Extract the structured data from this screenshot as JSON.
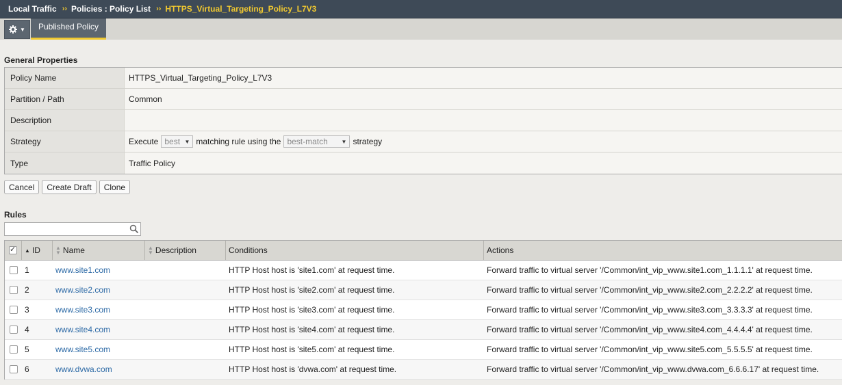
{
  "breadcrumb": {
    "items": [
      "Local Traffic",
      "Policies : Policy List"
    ],
    "separator": "››",
    "current": "HTTPS_Virtual_Targeting_Policy_L7V3"
  },
  "tabs": {
    "gear_icon": "gear-icon",
    "active_label": "Published Policy"
  },
  "general": {
    "title": "General Properties",
    "rows": [
      {
        "label": "Policy Name",
        "value": "HTTPS_Virtual_Targeting_Policy_L7V3"
      },
      {
        "label": "Partition / Path",
        "value": "Common"
      },
      {
        "label": "Description",
        "value": ""
      },
      {
        "label": "Strategy",
        "value": ""
      },
      {
        "label": "Type",
        "value": "Traffic Policy"
      }
    ],
    "strategy": {
      "prefix": "Execute",
      "first_select": "best",
      "middle": "matching rule using the",
      "second_select": "best-match",
      "suffix": "strategy"
    }
  },
  "buttons": {
    "cancel": "Cancel",
    "create_draft": "Create Draft",
    "clone": "Clone"
  },
  "rules": {
    "title": "Rules",
    "search_value": "",
    "columns": {
      "id": "ID",
      "name": "Name",
      "description": "Description",
      "conditions": "Conditions",
      "actions": "Actions"
    },
    "rows": [
      {
        "id": "1",
        "name": "www.site1.com",
        "description": "",
        "conditions": "HTTP Host host is 'site1.com' at request time.",
        "actions": "Forward traffic to virtual server '/Common/int_vip_www.site1.com_1.1.1.1' at request time."
      },
      {
        "id": "2",
        "name": "www.site2.com",
        "description": "",
        "conditions": "HTTP Host host is 'site2.com' at request time.",
        "actions": "Forward traffic to virtual server '/Common/int_vip_www.site2.com_2.2.2.2' at request time."
      },
      {
        "id": "3",
        "name": "www.site3.com",
        "description": "",
        "conditions": "HTTP Host host is 'site3.com' at request time.",
        "actions": "Forward traffic to virtual server '/Common/int_vip_www.site3.com_3.3.3.3' at request time."
      },
      {
        "id": "4",
        "name": "www.site4.com",
        "description": "",
        "conditions": "HTTP Host host is 'site4.com' at request time.",
        "actions": "Forward traffic to virtual server '/Common/int_vip_www.site4.com_4.4.4.4' at request time."
      },
      {
        "id": "5",
        "name": "www.site5.com",
        "description": "",
        "conditions": "HTTP Host host is 'site5.com' at request time.",
        "actions": "Forward traffic to virtual server '/Common/int_vip_www.site5.com_5.5.5.5' at request time."
      },
      {
        "id": "6",
        "name": "www.dvwa.com",
        "description": "",
        "conditions": "HTTP Host host is 'dvwa.com' at request time.",
        "actions": "Forward traffic to virtual server '/Common/int_vip_www.dvwa.com_6.6.6.17' at request time."
      }
    ]
  },
  "colors": {
    "nav_bg": "#3e4a57",
    "accent": "#f0c830",
    "link": "#2d6aa6"
  }
}
